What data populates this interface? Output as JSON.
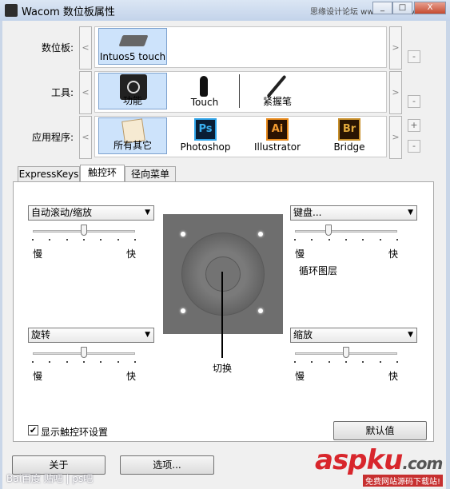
{
  "window": {
    "title": "Wacom 数位板属性",
    "watermark_top": "思缘设计论坛 www.MISSYUAN.com",
    "min": "_",
    "max": "□",
    "close": "X"
  },
  "rows": {
    "tablet": {
      "label": "数位板:",
      "items": [
        "Intuos5 touch"
      ]
    },
    "tool": {
      "label": "工具:",
      "items": [
        "功能",
        "Touch",
        "紧握笔"
      ]
    },
    "app": {
      "label": "应用程序:",
      "items": [
        "所有其它",
        "Photoshop",
        "Illustrator",
        "Bridge"
      ]
    }
  },
  "nav": {
    "left": "<",
    "right": ">",
    "plus": "+",
    "minus": "-"
  },
  "app_icons": {
    "ps": "Ps",
    "ai": "Ai",
    "br": "Br"
  },
  "tabs": [
    "ExpressKeys",
    "触控环",
    "径向菜单"
  ],
  "active_tab": "触控环",
  "panel": {
    "mode1": {
      "dropdown": "自动滚动/缩放",
      "slow": "慢",
      "fast": "快",
      "level": 0.5
    },
    "mode2": {
      "dropdown": "键盘...",
      "slow": "慢",
      "fast": "快",
      "level": 0.33,
      "extra": "循环图层"
    },
    "mode3": {
      "dropdown": "旋转",
      "slow": "慢",
      "fast": "快",
      "level": 0.5
    },
    "mode4": {
      "dropdown": "缩放",
      "slow": "慢",
      "fast": "快",
      "level": 0.5
    },
    "toggle_label": "切换",
    "checkbox_label": "显示触控环设置",
    "checkbox_checked": true,
    "default_button": "默认值"
  },
  "bottom": {
    "about": "关于",
    "options": "选项...",
    "watermark_baidu": "Bai百度 贴吧 | ps吧",
    "watermark_asp": "aspku",
    "watermark_asp_tld": ".com",
    "watermark_asp_sub": "免费网站源码下载站!"
  }
}
